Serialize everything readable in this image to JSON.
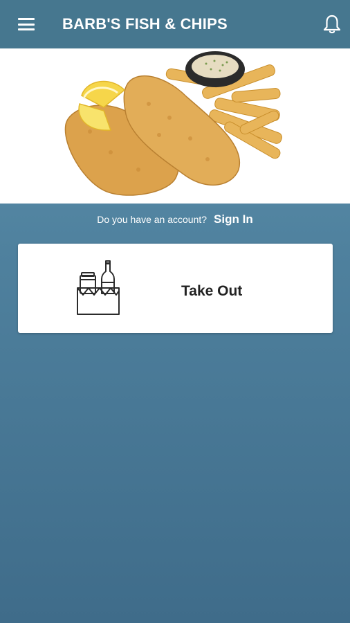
{
  "header": {
    "title": "BARB'S FISH & CHIPS",
    "menu_icon": "menu-icon",
    "notification_icon": "bell-icon"
  },
  "carousel": {
    "slide_count": 5,
    "active_index": 0
  },
  "account": {
    "question": "Do you have an account?",
    "sign_in_label": "Sign In"
  },
  "options": [
    {
      "label": "Take Out",
      "icon": "takeout-bag-icon"
    }
  ],
  "colors": {
    "header_bg": "#46778f",
    "background_top": "#6197b2",
    "background_bottom": "#3f6c8a",
    "active_dot": "#4b87ac"
  }
}
